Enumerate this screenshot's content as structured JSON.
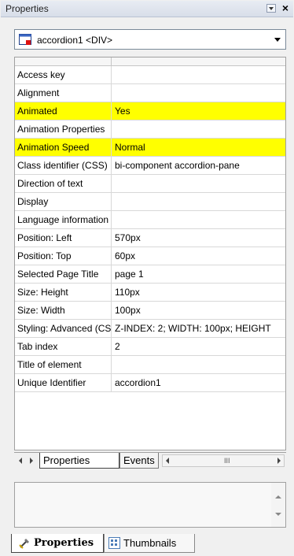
{
  "window": {
    "title": "Properties"
  },
  "selector": {
    "value": "accordion1 <DIV>"
  },
  "properties": [
    {
      "name": "Access key",
      "value": "",
      "highlighted": false
    },
    {
      "name": "Alignment",
      "value": "",
      "highlighted": false
    },
    {
      "name": "Animated",
      "value": "Yes",
      "highlighted": true
    },
    {
      "name": "Animation Properties",
      "value": "",
      "highlighted": false
    },
    {
      "name": "Animation Speed",
      "value": "Normal",
      "highlighted": true
    },
    {
      "name": "Class identifier (CSS)",
      "value": "bi-component accordion-pane",
      "highlighted": false
    },
    {
      "name": "Direction of text",
      "value": "",
      "highlighted": false
    },
    {
      "name": "Display",
      "value": "",
      "highlighted": false
    },
    {
      "name": "Language information",
      "value": "",
      "highlighted": false
    },
    {
      "name": "Position: Left",
      "value": "570px",
      "highlighted": false
    },
    {
      "name": "Position: Top",
      "value": "60px",
      "highlighted": false
    },
    {
      "name": "Selected Page Title",
      "value": "page 1",
      "highlighted": false
    },
    {
      "name": "Size: Height",
      "value": "110px",
      "highlighted": false
    },
    {
      "name": "Size: Width",
      "value": "100px",
      "highlighted": false
    },
    {
      "name": "Styling: Advanced (CSS)",
      "value": "Z-INDEX: 2; WIDTH: 100px; HEIGHT",
      "highlighted": false
    },
    {
      "name": "Tab index",
      "value": "2",
      "highlighted": false
    },
    {
      "name": "Title of element",
      "value": "",
      "highlighted": false
    },
    {
      "name": "Unique Identifier",
      "value": "accordion1",
      "highlighted": false
    }
  ],
  "inner_tabs": {
    "properties": "Properties",
    "events": "Events"
  },
  "scroll_grip": "III",
  "bottom_tabs": {
    "properties": "Properties",
    "thumbnails": "Thumbnails"
  },
  "colors": {
    "highlight": "#ffff00",
    "grid_line": "#d8d8d8"
  }
}
